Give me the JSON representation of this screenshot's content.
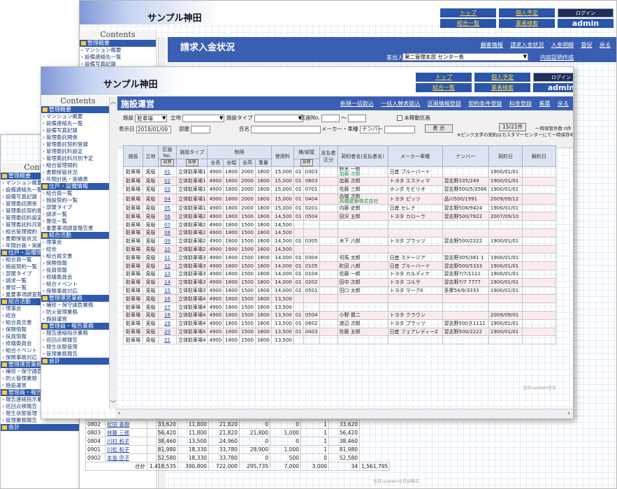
{
  "app_title": "サンプル神田",
  "topnav": {
    "top": "トップ",
    "personal": "個人予定",
    "login": "ログイン",
    "union": "組合一覧",
    "business": "業者検索",
    "user": "admin"
  },
  "sidebar": {
    "contents_label": "Contents",
    "items": [
      {
        "type": "sec",
        "label": "管理概要"
      },
      {
        "type": "item",
        "label": "マンション概要"
      },
      {
        "type": "item",
        "label": "設備連絡先一覧"
      },
      {
        "type": "item",
        "label": "設備写真記録"
      },
      {
        "type": "item",
        "label": "管理委託関係"
      },
      {
        "type": "item",
        "label": "管理委託契約登録"
      },
      {
        "type": "item",
        "label": "管理委託料設定"
      },
      {
        "type": "item",
        "label": "管理委託料月別予定"
      },
      {
        "type": "item",
        "label": "組合管理規約"
      },
      {
        "type": "item",
        "label": "書類保管状況"
      },
      {
        "type": "item",
        "label": "年間計画・実績表"
      },
      {
        "type": "sec",
        "label": "住戸・設備情報"
      },
      {
        "type": "item",
        "label": "組合員一覧"
      },
      {
        "type": "item",
        "label": "施設契約一覧"
      },
      {
        "type": "item",
        "label": "部屋タイプ"
      },
      {
        "type": "item",
        "label": "請求一覧"
      },
      {
        "type": "item",
        "label": "督促一覧"
      },
      {
        "type": "item",
        "label": "重要事項調査報告書"
      },
      {
        "type": "sec",
        "label": "組合活動"
      },
      {
        "type": "item",
        "label": "理事会"
      },
      {
        "type": "item",
        "label": "総会"
      },
      {
        "type": "item",
        "label": "組合員文書"
      },
      {
        "type": "item",
        "label": "保険情報"
      },
      {
        "type": "item",
        "label": "役員情報"
      },
      {
        "type": "item",
        "label": "修繕委員会"
      },
      {
        "type": "item",
        "label": "組合イベント"
      },
      {
        "type": "item",
        "label": "保険事故対応"
      },
      {
        "type": "sec",
        "label": "管理運営業務"
      },
      {
        "type": "item",
        "label": "補修・保守請負業務"
      },
      {
        "type": "item",
        "label": "防火管理業務"
      },
      {
        "type": "item",
        "label": "施設運営"
      },
      {
        "type": "sec",
        "label": "管理員・報告業務"
      },
      {
        "type": "item",
        "label": "報告連絡指示業務"
      },
      {
        "type": "item",
        "label": "巡回点検報告"
      },
      {
        "type": "item",
        "label": "発生状態管理"
      },
      {
        "type": "item",
        "label": "管理業務報告"
      },
      {
        "type": "sec",
        "label": "会計"
      }
    ]
  },
  "back_window": {
    "title": "請求入金状況",
    "links": [
      "顧客情報",
      "請求入金状況",
      "入金明細",
      "督促",
      "戻る"
    ],
    "sender_label": "差出人",
    "sender_value": "第二管理本部 センター長",
    "doc_link": "内容証明作成",
    "rows": [
      [
        "0802",
        "松田 喜樹",
        "33,620",
        "11,800",
        "21,820",
        "0",
        "0",
        "1",
        "33,620"
      ],
      [
        "0803",
        "林藤 三郎",
        "56,420",
        "11,800",
        "21,820",
        "21,800",
        "1,000",
        "1",
        "56,420"
      ],
      [
        "0804",
        "川村 和子",
        "38,460",
        "13,500",
        "24,960",
        "0",
        "0",
        "1",
        "38,460"
      ],
      [
        "0901",
        "川松 和子",
        "81,980",
        "18,330",
        "33,780",
        "28,900",
        "1,000",
        "1",
        "81,980"
      ],
      [
        "0902",
        "本島 忠子",
        "52,580",
        "18,330",
        "33,780",
        "0",
        "500",
        "0",
        "52,580"
      ]
    ],
    "total_label": "合計",
    "total": [
      "1,418,535",
      "390,800",
      "722,000",
      "295,735",
      "7,000",
      "3,000",
      "34",
      "1,561,795"
    ],
    "footer": "全日-system全日@株式"
  },
  "front_window": {
    "title": "施設運営",
    "links": [
      "新規一括取込",
      "一括入替表取込",
      "区画情報登録",
      "契約条件登録",
      "料金登録",
      "帳票",
      "戻る"
    ],
    "filter": {
      "facility_label": "施設",
      "facility_value": "駐車場",
      "location_label": "立地",
      "location_value": "",
      "type_label": "施設タイプ",
      "type_value": "",
      "section_label": "区画No.",
      "section_sep": "～",
      "unused_label": "未稼動区画",
      "display_date_label": "表示日",
      "display_date_value": "2018/01/09",
      "room_label": "部屋",
      "name_label": "氏名",
      "maker_label": "メーカー・車種",
      "number_label": "ナンバー",
      "show_button": "表 示",
      "count": "15/21件",
      "note1": "一時保管件数:0件",
      "note2": "※ピンク文字の契約はカスタマーセンターにて一時保存中です。"
    },
    "columns": {
      "facility": "施設",
      "location": "立地",
      "section": "区画No.",
      "type": "施設タイプ",
      "limit": "制限",
      "full_len": "全長",
      "full_width": "全幅",
      "full_height": "全高",
      "weight": "重量",
      "fee": "使用料",
      "building": "棟/部屋",
      "payer": "支払者区分",
      "contractor": "契約者名(支払者名)",
      "maker": "メーカー車種",
      "number": "ナンバー",
      "contract_date": "契約日",
      "cancel_date": "解約日",
      "sort": "並替"
    },
    "rows": [
      [
        "駐車場",
        "見桜",
        "01",
        "立体駐車場1",
        "4900",
        "1800",
        "2000",
        "1800",
        "15,000",
        "01",
        "0303",
        "",
        "鈴木 一郎",
        "日産 ブルーバード",
        "",
        "1900/01/01",
        ""
      ],
      [
        "駐車場",
        "見桜",
        "02",
        "立体駐車場1",
        "4900",
        "1800",
        "2000",
        "1800",
        "15,000",
        "01",
        "0603",
        "",
        "加藤 次郎",
        "トヨタ エスティマ",
        "習志野335/249",
        "1900/01/01",
        ""
      ],
      [
        "駐車場",
        "見桜",
        "03",
        "立体駐車場1",
        "4900",
        "1800",
        "2000",
        "1800",
        "15,000",
        "01",
        "0701",
        "",
        "佐藤 三郎",
        "ホンダ モビリオ",
        "習志野500/5/3566",
        "1900/01/01",
        ""
      ],
      [
        "駐車場",
        "見桜",
        "04",
        "立体駐車場1",
        "4900",
        "1800",
        "2000",
        "1800",
        "15,000",
        "01",
        "0404",
        "",
        "高橋 次郎",
        "トヨタ ピッツ",
        "品川500/1991",
        "2009/09/12",
        ""
      ],
      [
        "駐車場",
        "見桜",
        "05",
        "立体駐車場1",
        "4900",
        "1800",
        "2000",
        "1800",
        "15,000",
        "01",
        "0201",
        "",
        "内藤 史郎",
        "日産 セレナ",
        "習志野508/9424",
        "1900/01/01",
        ""
      ],
      [
        "駐車場",
        "見桜",
        "06",
        "立体駐車場2",
        "4900",
        "1800",
        "1500",
        "1800",
        "14,500",
        "01",
        "0504",
        "",
        "田沢 五郎",
        "トヨタ カローラ",
        "習志野500/7822",
        "2007/09/10",
        ""
      ],
      [
        "駐車場",
        "見桜",
        "07",
        "立体駐車場2",
        "4900",
        "1800",
        "1500",
        "1800",
        "14,500",
        "",
        "",
        "",
        "",
        "",
        "",
        "",
        ""
      ],
      [
        "駐車場",
        "見桜",
        "08",
        "立体駐車場2",
        "4900",
        "1800",
        "1500",
        "1800",
        "14,500",
        "",
        "",
        "",
        "",
        "",
        "",
        "",
        ""
      ],
      [
        "駐車場",
        "見桜",
        "09",
        "立体駐車場2",
        "4900",
        "1800",
        "1500",
        "1800",
        "14,500",
        "01",
        "0305",
        "",
        "木下 六郎",
        "トヨタ プラッツ",
        "習志野500/2222",
        "1900/01/01",
        ""
      ],
      [
        "駐車場",
        "見桜",
        "10",
        "立体駐車場2",
        "4900",
        "1800",
        "1500",
        "1800",
        "14,500",
        "",
        "",
        "",
        "",
        "",
        "",
        "",
        ""
      ],
      [
        "駐車場",
        "見桜",
        "11",
        "立体駐車場3",
        "4900",
        "1800",
        "1500",
        "1800",
        "14,000",
        "01",
        "0304",
        "",
        "司馬 太郎",
        "日産 ステージア",
        "習志野305/381 1",
        "1900/01/01",
        ""
      ],
      [
        "駐車場",
        "見桜",
        "12",
        "立体駐車場3",
        "4900",
        "1800",
        "1500",
        "1800",
        "14,000",
        "01",
        "0105",
        "",
        "町田 八郎",
        "日産 ブルーバード",
        "習志野500/5333",
        "1900/01/01",
        ""
      ],
      [
        "駐車場",
        "見桜",
        "13",
        "立体駐車場3",
        "4900",
        "1800",
        "1500",
        "1800",
        "14,000",
        "01",
        "0104",
        "",
        "佐藤 一郎",
        "トヨタ カルディナ",
        "習志野7/7/1111",
        "1900/01/01",
        ""
      ],
      [
        "駐車場",
        "見桜",
        "14",
        "立体駐車場3",
        "4900",
        "1800",
        "1500",
        "1800",
        "14,000",
        "01",
        "0202",
        "",
        "田中 次郎",
        "トヨタ コルサ",
        "習志野7/7 7777",
        "1900/01/01",
        ""
      ],
      [
        "駐車場",
        "見桜",
        "15",
        "立体駐車場3",
        "4900",
        "1800",
        "1500",
        "1800",
        "14,000",
        "01",
        "0501",
        "",
        "田口 太郎",
        "トヨタ マークⅡ",
        "多摩54/9/3333",
        "1900/01/01",
        ""
      ],
      [
        "駐車場",
        "見桜",
        "16",
        "立体駐車場4",
        "4900",
        "1800",
        "1500",
        "1800",
        "13,500",
        "",
        "",
        "",
        "",
        "",
        "",
        "",
        ""
      ],
      [
        "駐車場",
        "見桜",
        "17",
        "立体駐車場4",
        "4900",
        "1800",
        "1500",
        "1800",
        "13,500",
        "",
        "",
        "",
        "",
        "",
        "",
        "",
        ""
      ],
      [
        "駐車場",
        "見桜",
        "18",
        "立体駐車場4",
        "4900",
        "1800",
        "1500",
        "1800",
        "13,500",
        "01",
        "0504",
        "",
        "小野 健二",
        "トヨタ クラウン",
        "",
        "2009/09/01",
        ""
      ],
      [
        "駐車場",
        "見桜",
        "19",
        "立体駐車場4",
        "4900",
        "1800",
        "1500",
        "1800",
        "13,500",
        "01",
        "0602",
        "",
        "渡辺 次郎",
        "トヨタ プラッツ",
        "習志野500き1111",
        "1900/01/01",
        ""
      ],
      [
        "駐車場",
        "見桜",
        "20",
        "立体駐車場4",
        "4900",
        "1800",
        "1500",
        "1800",
        "13,500",
        "01",
        "0403",
        "",
        "佐藤 五郎",
        "日産 フェアレディーZ",
        "習志野500/2222",
        "1900/01/01",
        ""
      ],
      [
        "駐車場",
        "見桜",
        "21",
        "立体駐車場4",
        "4900",
        "1800",
        "1500",
        "1800",
        "13,500",
        "",
        "",
        "",
        "",
        "",
        "",
        "",
        ""
      ]
    ],
    "row1_sub": "加藤 次郎",
    "row4_sub": "高橋建築株式会社",
    "footer": "全日-system全日"
  }
}
